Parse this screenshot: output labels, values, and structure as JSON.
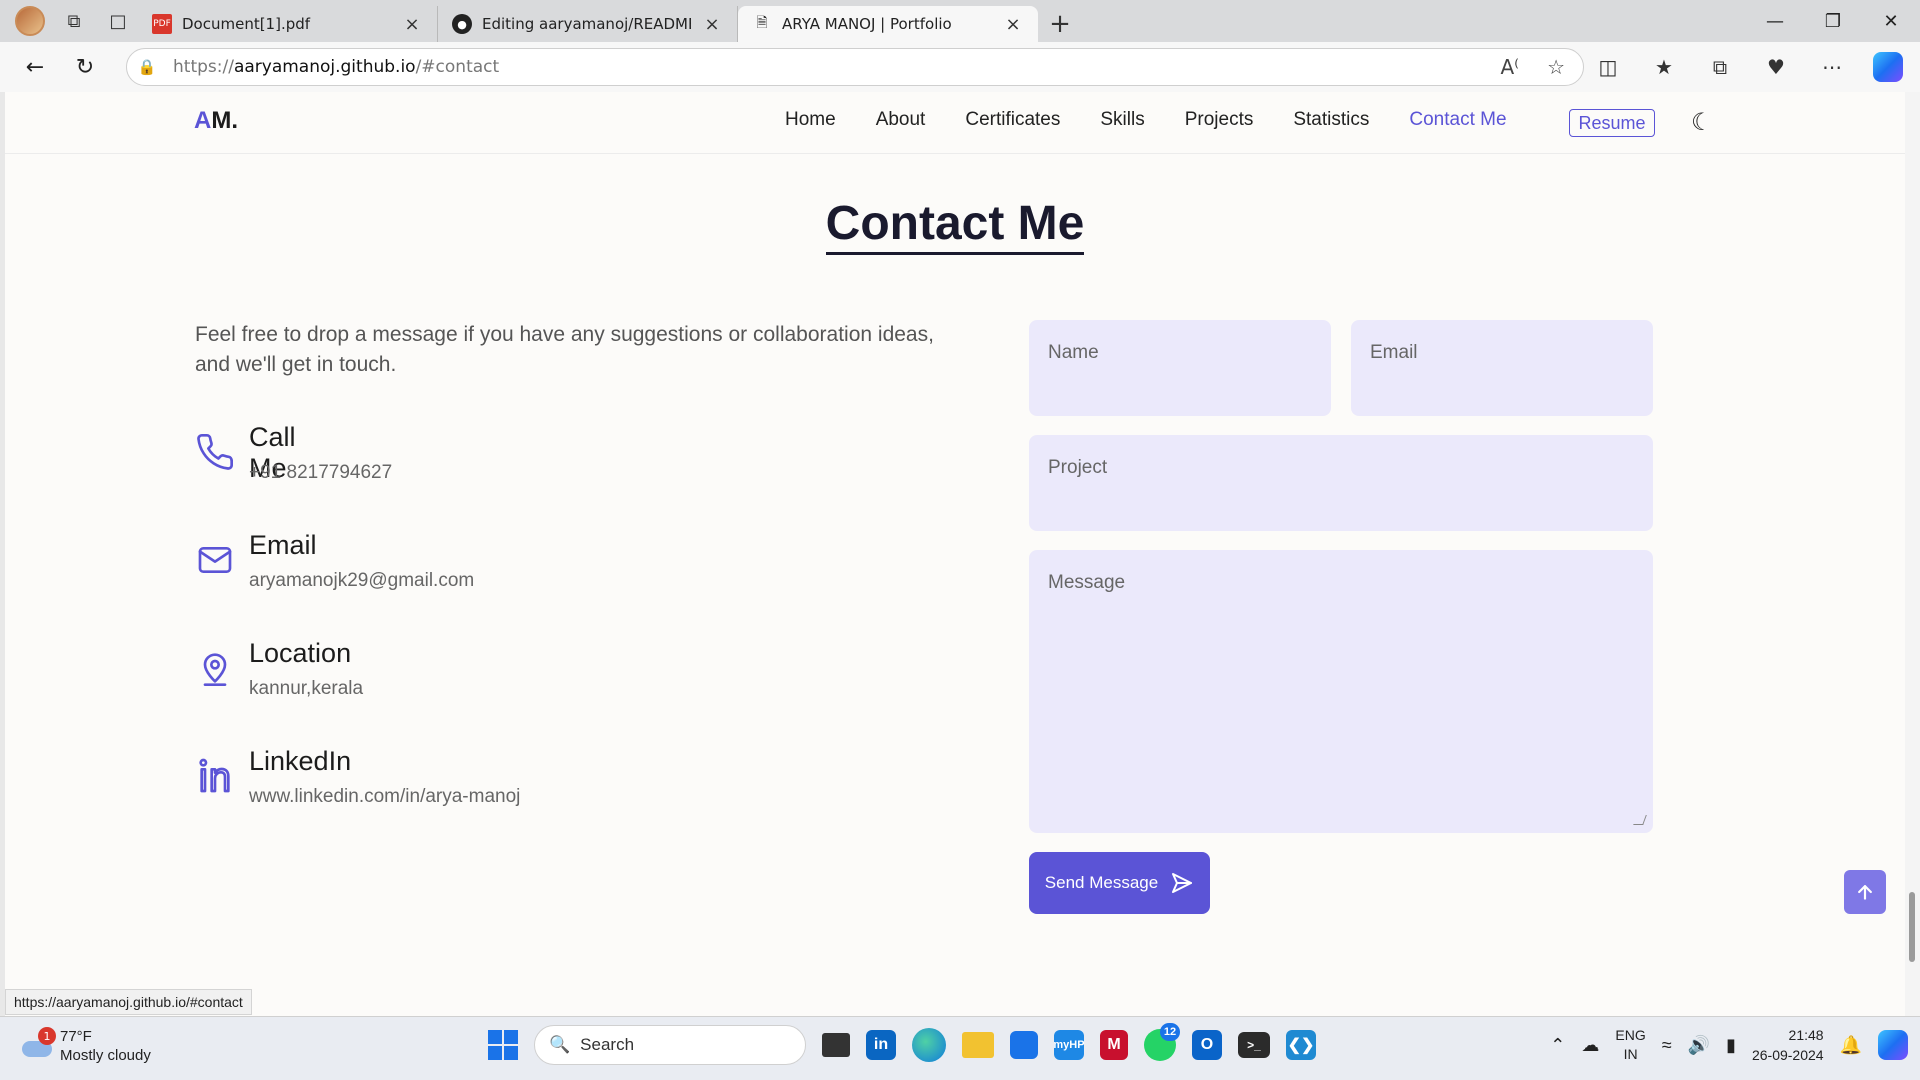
{
  "browser": {
    "tabs": [
      {
        "title": "Document[1].pdf",
        "icon": "pdf-icon",
        "active": false
      },
      {
        "title": "Editing aaryamanoj/README.md",
        "icon": "github-icon",
        "active": false
      },
      {
        "title": "ARYA MANOJ | Portfolio",
        "icon": "page-icon",
        "active": true
      }
    ],
    "url_prefix": "https://",
    "url_host": "aaryamanoj.github.io",
    "url_path": "/#contact",
    "status_url": "https://aaryamanoj.github.io/#contact"
  },
  "nav": {
    "logo_accent": "A",
    "logo_rest": "M.",
    "links": [
      "Home",
      "About",
      "Certificates",
      "Skills",
      "Projects",
      "Statistics",
      "Contact Me"
    ],
    "active_link": "Contact Me",
    "resume_label": "Resume"
  },
  "contact": {
    "title": "Contact Me",
    "intro": "Feel free to drop a message if you have any suggestions or collaboration ideas, and we'll get in touch.",
    "items": [
      {
        "label": "Call Me",
        "value": "+91 8217794627",
        "icon": "phone-icon"
      },
      {
        "label": "Email",
        "value": "aryamanojk29@gmail.com",
        "icon": "mail-icon"
      },
      {
        "label": "Location",
        "value": "kannur,kerala",
        "icon": "location-pin-icon"
      },
      {
        "label": "LinkedIn",
        "value": "www.linkedin.com/in/arya-manoj",
        "icon": "linkedin-icon"
      }
    ],
    "form": {
      "name_placeholder": "Name",
      "email_placeholder": "Email",
      "project_placeholder": "Project",
      "message_placeholder": "Message",
      "send_label": "Send Message"
    }
  },
  "taskbar": {
    "weather_temp": "77°F",
    "weather_desc": "Mostly cloudy",
    "weather_badge": "1",
    "search_label": "Search",
    "whatsapp_count": "12",
    "lang_top": "ENG",
    "lang_bottom": "IN",
    "time": "21:48",
    "date": "26-09-2024"
  },
  "colors": {
    "accent": "#5b54d6",
    "field_bg": "#ebe9fb",
    "page_bg": "#fcfbf9"
  }
}
